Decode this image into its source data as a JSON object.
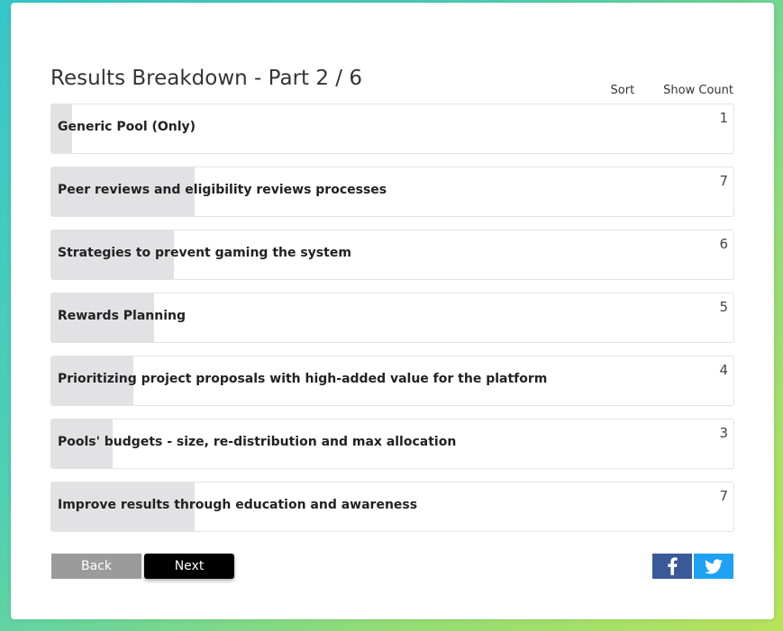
{
  "page": {
    "title": "Results Breakdown - Part 2 / 6"
  },
  "controls": {
    "sort_label": "Sort",
    "show_count_label": "Show Count"
  },
  "results": [
    {
      "label": "Generic Pool (Only)",
      "count": "1",
      "share": 0.03
    },
    {
      "label": "Peer reviews and eligibility reviews processes",
      "count": "7",
      "share": 0.21
    },
    {
      "label": "Strategies to prevent gaming the system",
      "count": "6",
      "share": 0.18
    },
    {
      "label": "Rewards Planning",
      "count": "5",
      "share": 0.15
    },
    {
      "label": "Prioritizing project proposals with high-added value for the platform",
      "count": "4",
      "share": 0.12
    },
    {
      "label": "Pools' budgets - size, re-distribution and max allocation",
      "count": "3",
      "share": 0.09
    },
    {
      "label": "Improve results through education and awareness",
      "count": "7",
      "share": 0.21
    }
  ],
  "nav": {
    "back_label": "Back",
    "next_label": "Next"
  },
  "social": {
    "facebook_icon": "facebook-icon",
    "twitter_icon": "twitter-icon",
    "facebook_color": "#3b5998",
    "twitter_color": "#1da1f2"
  },
  "colors": {
    "bar_fill": "#e2e1e3",
    "back_button": "#9b9b9b",
    "next_button": "#000000"
  }
}
